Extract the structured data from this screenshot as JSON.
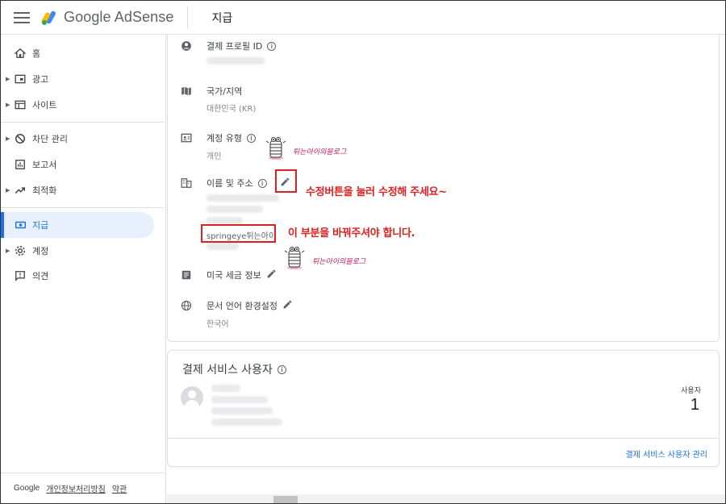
{
  "header": {
    "app_name": "Google AdSense",
    "page_title": "지급"
  },
  "sidebar": {
    "items": [
      {
        "label": "홈",
        "icon": "home-icon"
      },
      {
        "label": "광고",
        "icon": "ads-icon"
      },
      {
        "label": "사이트",
        "icon": "sites-icon"
      },
      {
        "label": "차단 관리",
        "icon": "block-icon"
      },
      {
        "label": "보고서",
        "icon": "reports-icon"
      },
      {
        "label": "최적화",
        "icon": "optimize-icon"
      },
      {
        "label": "지급",
        "icon": "payments-icon"
      },
      {
        "label": "계정",
        "icon": "gear-icon"
      },
      {
        "label": "의견",
        "icon": "feedback-icon"
      }
    ],
    "footer": {
      "brand": "Google",
      "privacy": "개인정보처리방침",
      "terms": "약관"
    }
  },
  "settings": {
    "profile_id_label": "결제 프로필 ID",
    "country_label": "국가/지역",
    "country_value": "대한민국 (KR)",
    "account_type_label": "계정 유형",
    "account_type_value": "개인",
    "name_address_label": "이름 및 주소",
    "name_value": "springeye튀는아이",
    "us_tax_label": "미국 세금 정보",
    "language_label": "문서 언어 환경설정",
    "language_value": "한국어"
  },
  "payment_users": {
    "title": "결제 서비스 사용자",
    "count_label": "사용자",
    "count": "1",
    "manage_link": "결제 서비스 사용자 관리"
  },
  "annotations": {
    "edit_hint": "수정버튼을 눌러 수정해 주세요~",
    "change_hint": "이 부분을 바꿔주셔야 합니다.",
    "signature": "튀는아이의블로그"
  },
  "colors": {
    "accent": "#1a73e8",
    "annotation_red": "#e02020",
    "active_bg": "#e8f0fe"
  }
}
